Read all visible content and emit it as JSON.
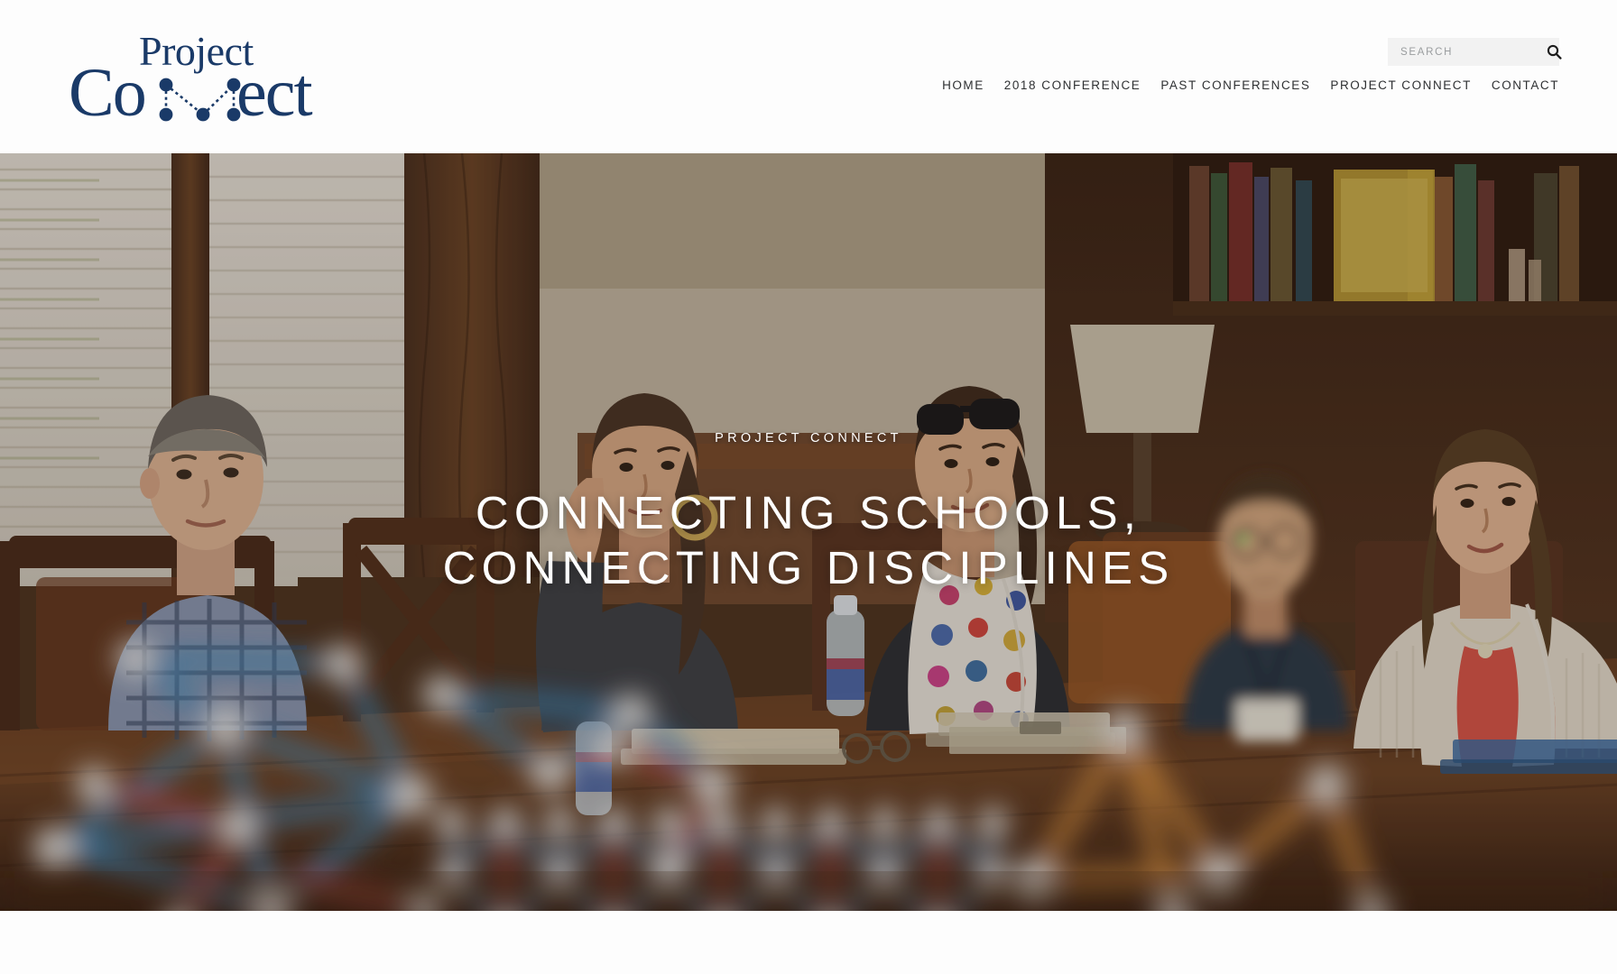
{
  "site": {
    "logo_line1": "Project",
    "logo_line2_pre": "Co",
    "logo_line2_post": "ect",
    "logo_alt": "Project Connect",
    "logo_color": "#1a3a68"
  },
  "search": {
    "placeholder": "SEARCH",
    "value": "",
    "icon": "search-icon"
  },
  "nav": {
    "items": [
      {
        "label": "HOME"
      },
      {
        "label": "2018 CONFERENCE"
      },
      {
        "label": "PAST CONFERENCES"
      },
      {
        "label": "PROJECT CONNECT"
      },
      {
        "label": "CONTACT"
      }
    ]
  },
  "hero": {
    "eyebrow": "PROJECT CONNECT",
    "title_line1": "CONNECTING SCHOOLS,",
    "title_line2": "CONNECTING DISCIPLINES",
    "text_color": "#ffffff",
    "scene": "Conference room with participants seated at a wood table, molecular model kits in the blurred foreground"
  }
}
